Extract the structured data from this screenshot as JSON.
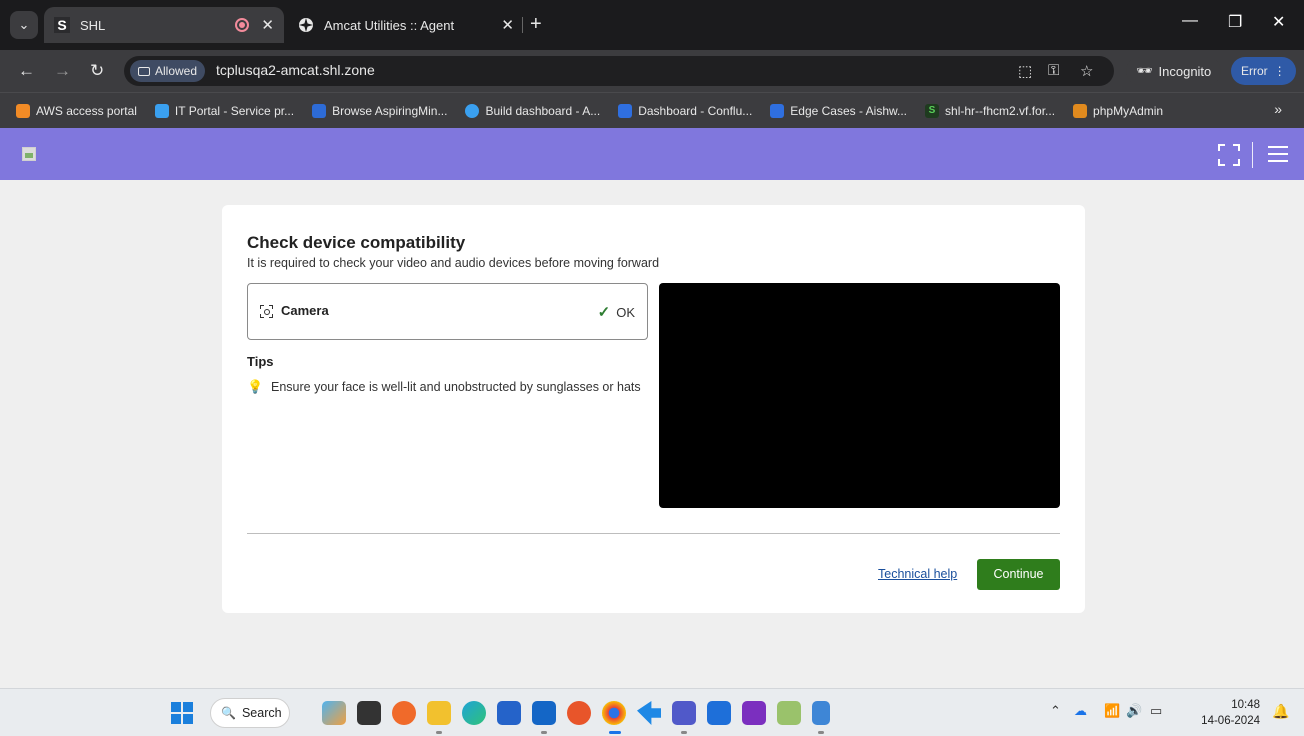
{
  "browser": {
    "tabs": [
      {
        "title": "SHL",
        "favicon": "S",
        "active": true
      },
      {
        "title": "Amcat Utilities :: Agent",
        "active": false
      }
    ],
    "new_tab_label": "+",
    "address": {
      "permission_chip": "Allowed",
      "url": "tcplusqa2-amcat.shl.zone"
    },
    "incognito_label": "Incognito",
    "error_label": "Error",
    "bookmarks": [
      {
        "label": "AWS access portal",
        "color": "#f28b26"
      },
      {
        "label": "IT Portal - Service pr...",
        "color": "#3aa0f0"
      },
      {
        "label": "Browse AspiringMin...",
        "color": "#2d6bd6"
      },
      {
        "label": "Build dashboard - A...",
        "color": "#3aa0f0"
      },
      {
        "label": "Dashboard - Conflu...",
        "color": "#2f6fe0"
      },
      {
        "label": "Edge Cases - Aishw...",
        "color": "#2f6fe0"
      },
      {
        "label": "shl-hr--fhcm2.vf.for...",
        "color": "#3a8a3a",
        "glyph": "S"
      },
      {
        "label": "phpMyAdmin",
        "color": "#e08a1e"
      }
    ],
    "bookmarks_overflow": "»"
  },
  "page": {
    "header_color": "#8077dd",
    "card": {
      "title": "Check device compatibility",
      "subtitle": "It is required to check your video and audio devices before moving forward",
      "device": {
        "label": "Camera",
        "status": "OK"
      },
      "tips_title": "Tips",
      "tips": [
        "Ensure your face is well-lit and unobstructed by sunglasses or hats"
      ],
      "technical_help_label": "Technical help",
      "continue_label": "Continue"
    }
  },
  "taskbar": {
    "search_label": "Search",
    "clock_time": "10:48",
    "clock_date": "14-06-2024"
  }
}
